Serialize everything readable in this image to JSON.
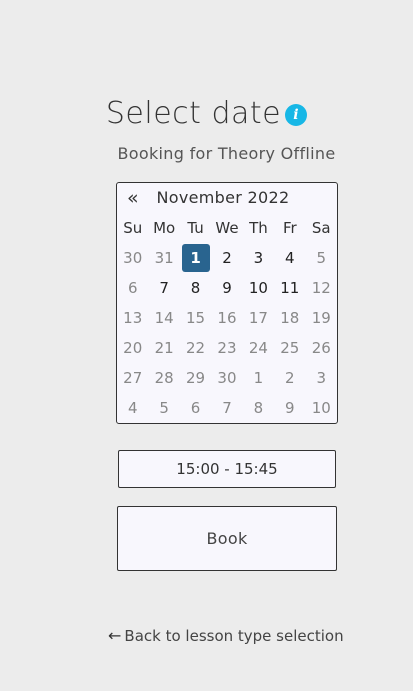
{
  "header": {
    "title": "Select date",
    "info_icon_glyph": "i",
    "subtitle": "Booking for Theory Offline"
  },
  "calendar": {
    "prev_glyph": "«",
    "month_label": "November 2022",
    "weekdays": [
      "Su",
      "Mo",
      "Tu",
      "We",
      "Th",
      "Fr",
      "Sa"
    ],
    "weeks": [
      [
        {
          "day": "30",
          "state": "muted"
        },
        {
          "day": "31",
          "state": "muted"
        },
        {
          "day": "1",
          "state": "selected"
        },
        {
          "day": "2",
          "state": "active"
        },
        {
          "day": "3",
          "state": "active"
        },
        {
          "day": "4",
          "state": "active"
        },
        {
          "day": "5",
          "state": "muted"
        }
      ],
      [
        {
          "day": "6",
          "state": "muted"
        },
        {
          "day": "7",
          "state": "active"
        },
        {
          "day": "8",
          "state": "active"
        },
        {
          "day": "9",
          "state": "active"
        },
        {
          "day": "10",
          "state": "active"
        },
        {
          "day": "11",
          "state": "active"
        },
        {
          "day": "12",
          "state": "muted"
        }
      ],
      [
        {
          "day": "13",
          "state": "muted"
        },
        {
          "day": "14",
          "state": "muted"
        },
        {
          "day": "15",
          "state": "muted"
        },
        {
          "day": "16",
          "state": "muted"
        },
        {
          "day": "17",
          "state": "muted"
        },
        {
          "day": "18",
          "state": "muted"
        },
        {
          "day": "19",
          "state": "muted"
        }
      ],
      [
        {
          "day": "20",
          "state": "muted"
        },
        {
          "day": "21",
          "state": "muted"
        },
        {
          "day": "22",
          "state": "muted"
        },
        {
          "day": "23",
          "state": "muted"
        },
        {
          "day": "24",
          "state": "muted"
        },
        {
          "day": "25",
          "state": "muted"
        },
        {
          "day": "26",
          "state": "muted"
        }
      ],
      [
        {
          "day": "27",
          "state": "muted"
        },
        {
          "day": "28",
          "state": "muted"
        },
        {
          "day": "29",
          "state": "muted"
        },
        {
          "day": "30",
          "state": "muted"
        },
        {
          "day": "1",
          "state": "muted"
        },
        {
          "day": "2",
          "state": "muted"
        },
        {
          "day": "3",
          "state": "muted"
        }
      ],
      [
        {
          "day": "4",
          "state": "muted"
        },
        {
          "day": "5",
          "state": "muted"
        },
        {
          "day": "6",
          "state": "muted"
        },
        {
          "day": "7",
          "state": "muted"
        },
        {
          "day": "8",
          "state": "muted"
        },
        {
          "day": "9",
          "state": "muted"
        },
        {
          "day": "10",
          "state": "muted"
        }
      ]
    ]
  },
  "time_slot": {
    "value": "15:00 - 15:45"
  },
  "book_button": {
    "label": "Book"
  },
  "back_link": {
    "arrow_glyph": "←",
    "label": "Back to lesson type selection"
  },
  "colors": {
    "background": "#ececec",
    "panel": "#f8f7fd",
    "selected_day": "#29648f",
    "info_icon": "#17b7e6",
    "muted_day": "#888888",
    "active_day": "#222222"
  }
}
